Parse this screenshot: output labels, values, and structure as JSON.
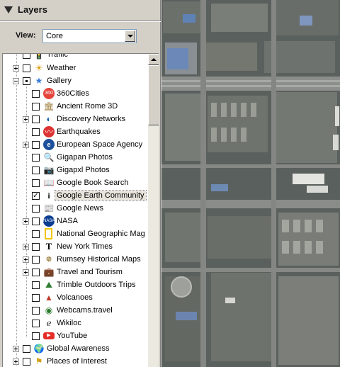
{
  "panel": {
    "title": "Layers",
    "view_label": "View:",
    "view_value": "Core"
  },
  "tree": {
    "items": [
      {
        "label": "Traffic",
        "icon": "traffic-icon"
      },
      {
        "label": "Weather",
        "icon": "sun-icon"
      },
      {
        "label": "Gallery",
        "icon": "star-icon"
      },
      {
        "label": "360Cities",
        "icon": "360cities-icon"
      },
      {
        "label": "Ancient Rome 3D",
        "icon": "columns-icon"
      },
      {
        "label": "Discovery Networks",
        "icon": "globe-icon"
      },
      {
        "label": "Earthquakes",
        "icon": "seismograph-icon"
      },
      {
        "label": "European Space Agency",
        "icon": "esa-icon"
      },
      {
        "label": "Gigapan Photos",
        "icon": "magnifier-icon"
      },
      {
        "label": "Gigapxl Photos",
        "icon": "camera-icon"
      },
      {
        "label": "Google Book Search",
        "icon": "book-icon"
      },
      {
        "label": "Google Earth Community",
        "icon": "info-icon"
      },
      {
        "label": "Google News",
        "icon": "newspaper-icon"
      },
      {
        "label": "NASA",
        "icon": "nasa-icon"
      },
      {
        "label": "National Geographic Mag",
        "icon": "natgeo-icon"
      },
      {
        "label": "New York Times",
        "icon": "nyt-icon"
      },
      {
        "label": "Rumsey Historical Maps",
        "icon": "compass-icon"
      },
      {
        "label": "Travel and Tourism",
        "icon": "bag-icon"
      },
      {
        "label": "Trimble Outdoors Trips",
        "icon": "route-icon"
      },
      {
        "label": "Volcanoes",
        "icon": "volcano-icon"
      },
      {
        "label": "Webcams.travel",
        "icon": "webcam-icon"
      },
      {
        "label": "Wikiloc",
        "icon": "wikiloc-icon"
      },
      {
        "label": "YouTube",
        "icon": "youtube-icon"
      },
      {
        "label": "Global Awareness",
        "icon": "earth-icon"
      },
      {
        "label": "Places of Interest",
        "icon": "flag-icon"
      }
    ]
  },
  "colors": {
    "panel_bg": "#d4d0c8",
    "tree_bg": "#ffffff",
    "map_base": "#565c5a"
  }
}
